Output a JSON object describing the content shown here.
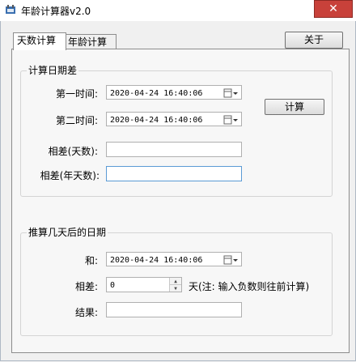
{
  "window": {
    "title": "年龄计算器v2.0"
  },
  "tabs": [
    {
      "label": "天数计算",
      "active": true
    },
    {
      "label": "年龄计算",
      "active": false
    }
  ],
  "buttons": {
    "close_label": "关于",
    "calc_label": "计算"
  },
  "diff_group": {
    "title": "计算日期差",
    "first_time_label": "第一时间:",
    "first_time_value": "2020-04-24 16:40:06",
    "second_time_label": "第二时间:",
    "second_time_value": "2020-04-24 16:40:06",
    "days_label": "相差(天数):",
    "days_value": "",
    "yeardays_label": "相差(年天数):",
    "yeardays_value": ""
  },
  "after_group": {
    "title": "推算几天后的日期",
    "and_label": "和:",
    "and_value": "2020-04-24 16:40:06",
    "diff_label": "相差:",
    "diff_value": "0",
    "unit_note": "天(注: 输入负数则往前计算)",
    "result_label": "结果:",
    "result_value": ""
  },
  "colors": {
    "close_red": "#c8413a",
    "focus_blue": "#5b9bd5"
  }
}
